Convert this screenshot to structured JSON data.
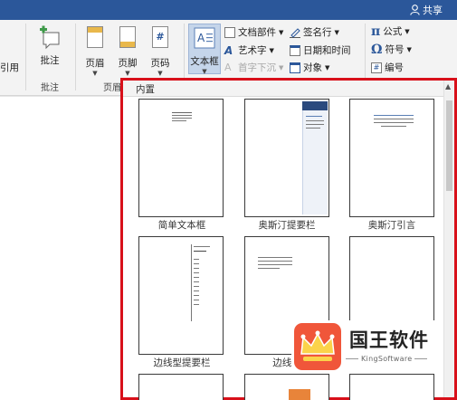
{
  "titlebar": {
    "share_label": "共享"
  },
  "ribbon": {
    "partial_left_label": "引用",
    "comment_label": "批注",
    "comment_group": "批注",
    "header_label": "页眉",
    "footer_label": "页脚",
    "page_number_label": "页码",
    "header_footer_group": "页眉",
    "textbox_label": "文本框",
    "doc_parts_label": "文档部件",
    "wordart_label": "艺术字",
    "dropcap_label": "首字下沉",
    "signature_label": "签名行",
    "datetime_label": "日期和时间",
    "object_label": "对象",
    "equation_label": "公式",
    "symbol_label": "符号",
    "number_label": "编号"
  },
  "gallery": {
    "section_header": "内置",
    "items": [
      {
        "caption": "简单文本框"
      },
      {
        "caption": "奥斯汀提要栏"
      },
      {
        "caption": "奥斯汀引言"
      },
      {
        "caption": "边线型提要栏"
      },
      {
        "caption": "边线型"
      },
      {
        "caption": ""
      }
    ]
  },
  "watermark": {
    "name": "国王软件",
    "sub": "KingSoftware"
  },
  "colors": {
    "titlebar": "#2b579a",
    "highlight_border": "#d8101a",
    "logo": "#f0563a"
  }
}
